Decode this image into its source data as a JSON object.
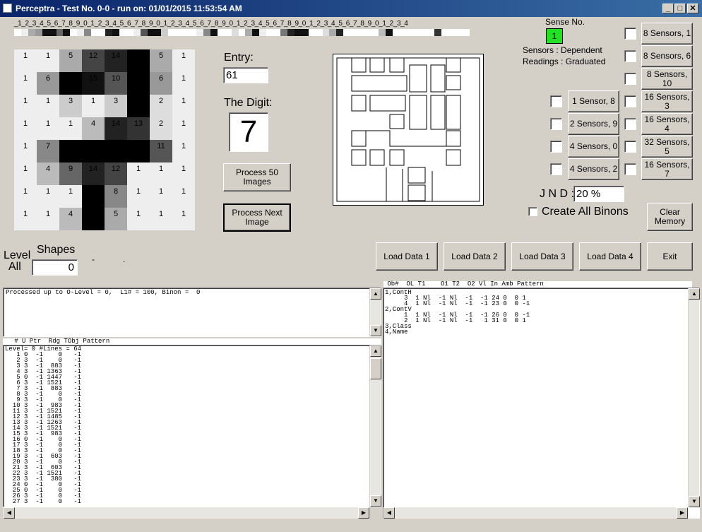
{
  "window": {
    "title": "Perceptra - Test No. 0-0 - run on: 01/01/2015  11:53:54 AM",
    "min": "_",
    "max": "□",
    "close": "✕"
  },
  "ruler": {
    "digits": "_1_2_3_4_5_6_7_8_9_0_1_2_3_4_5_6_7_8_9_0_1_2_3_4_5_6_7_8_9_0_1_2_3_4_5_6_7_8_9_0_1_2_3_4_5_6_7_8_9_0_1_2_3_4",
    "bar_shades": [
      "#fff",
      "#eee",
      "#aaa",
      "#999",
      "#111",
      "#111",
      "#666",
      "#111",
      "#fff",
      "#eee",
      "#888",
      "#fff",
      "#fff",
      "#222",
      "#111",
      "#fff",
      "#fff",
      "#eee",
      "#555",
      "#111",
      "#111",
      "#ccc",
      "#fff",
      "#fff",
      "#fff",
      "#fff",
      "#eee",
      "#888",
      "#111",
      "#fff",
      "#fff",
      "#ddd",
      "#fff",
      "#aaa",
      "#111",
      "#eee",
      "#fff",
      "#fff",
      "#777",
      "#222",
      "#111",
      "#111",
      "#fff",
      "#fff",
      "#ddd",
      "#aaa",
      "#222",
      "#fff",
      "#fff",
      "#fff",
      "#fff",
      "#fff",
      "#bbb",
      "#111",
      "#fff",
      "#fff",
      "#fff",
      "#fff",
      "#fff",
      "#fff",
      "#333",
      "#fff",
      "#fff",
      "#fff",
      "#fff"
    ]
  },
  "digit_grid": {
    "values": [
      [
        "1",
        "1",
        "5",
        "12",
        "14",
        "",
        "5",
        "1"
      ],
      [
        "1",
        "6",
        "",
        "15",
        "10",
        "",
        "6",
        "1"
      ],
      [
        "1",
        "1",
        "3",
        "1",
        "3",
        "",
        "2",
        "1"
      ],
      [
        "1",
        "1",
        "1",
        "4",
        "14",
        "13",
        "2",
        "1"
      ],
      [
        "1",
        "7",
        "",
        "",
        "",
        "",
        "11",
        "1"
      ],
      [
        "1",
        "4",
        "9",
        "14",
        "12",
        "1",
        "1",
        "1"
      ],
      [
        "1",
        "1",
        "1",
        "",
        "8",
        "1",
        "1",
        "1"
      ],
      [
        "1",
        "1",
        "4",
        "",
        "5",
        "1",
        "1",
        "1"
      ]
    ],
    "shades": [
      [
        "#eee",
        "#eee",
        "#aaa",
        "#444",
        "#222",
        "#000",
        "#aaa",
        "#eee"
      ],
      [
        "#eee",
        "#999",
        "#000",
        "#111",
        "#555",
        "#000",
        "#999",
        "#eee"
      ],
      [
        "#eee",
        "#eee",
        "#ccc",
        "#eee",
        "#ccc",
        "#000",
        "#ddd",
        "#eee"
      ],
      [
        "#eee",
        "#eee",
        "#eee",
        "#bbb",
        "#222",
        "#333",
        "#ddd",
        "#eee"
      ],
      [
        "#eee",
        "#888",
        "#000",
        "#000",
        "#000",
        "#000",
        "#555",
        "#eee"
      ],
      [
        "#eee",
        "#bbb",
        "#666",
        "#222",
        "#444",
        "#eee",
        "#eee",
        "#eee"
      ],
      [
        "#eee",
        "#eee",
        "#eee",
        "#000",
        "#888",
        "#eee",
        "#eee",
        "#eee"
      ],
      [
        "#eee",
        "#eee",
        "#bbb",
        "#000",
        "#aaa",
        "#eee",
        "#eee",
        "#eee"
      ]
    ]
  },
  "entry": {
    "label": "Entry:",
    "value": "61"
  },
  "digit": {
    "label": "The Digit:",
    "value": "7"
  },
  "buttons": {
    "process50": "Process 50 Images",
    "process_next": "Process Next Image",
    "load1": "Load Data 1",
    "load2": "Load Data 2",
    "load3": "Load Data 3",
    "load4": "Load Data 4",
    "exit": "Exit",
    "clear_memory": "Clear Memory"
  },
  "sense": {
    "label": "Sense No.",
    "value": "1",
    "sensors": "Sensors  :  Dependent",
    "readings": "Readings :  Graduated"
  },
  "sensor_buttons_right": [
    "8 Sensors, 1",
    "8 Sensors, 6",
    "8 Sensors, 10",
    "16 Sensors, 3",
    "16 Sensors, 4",
    "32 Sensors, 5",
    "16 Sensors, 7"
  ],
  "sensor_buttons_left": [
    "1 Sensor, 8",
    "2 Sensors, 9",
    "4 Sensors, 0",
    "4 Sensors, 2"
  ],
  "jnd": {
    "label": "J N D :",
    "value": "20 %"
  },
  "create_binons": "Create All Binons",
  "level": {
    "label": "Level",
    "sub": "All",
    "shapes_label": "Shapes",
    "shapes_value": "0",
    "dash": "-",
    "dot": "."
  },
  "status_text": "Processed up to O-Level = 0,  L1# = 100, Binon =  0",
  "list_header": "   # U Ptr  Rdg TObj Pattern",
  "list_text": "Level= 0 #Lines = 64\n   1 0  -1    0   -1\n   2 3  -1    0   -1\n   3 3  -1  883   -1\n   4 3  -1 1363   -1\n   5 0  -1 1447   -1\n   6 3  -1 1521   -1\n   7 3  -1  883   -1\n   8 3  -1    0   -1\n   9 3  -1    0   -1\n  10 3  -1  983   -1\n  11 3  -1 1521   -1\n  12 3  -1 1485   -1\n  13 3  -1 1263   -1\n  14 3  -1 1521   -1\n  15 3  -1  983   -1\n  16 0  -1    0   -1\n  17 3  -1    0   -1\n  18 3  -1    0   -1\n  19 3  -1  603   -1\n  20 3  -1    0   -1\n  21 3  -1  603   -1\n  22 3  -1 1521   -1\n  23 3  -1  380   -1\n  24 0  -1    0   -1\n  25 0  -1    0   -1\n  26 3  -1    0   -1\n  27 3  -1    0   -1",
  "obj_header": " Ob#  OL T1    O1 T2  O2 Vl In Amb Pattern",
  "obj_text": "1,ContH\n     3  1 Nl  -1 Nl  -1  -1 24 0  0 1\n     4  1 Nl  -1 Nl  -1  -1 23 0  0 -1\n2,ContV\n     1  1 Nl  -1 Nl  -1  -1 26 0  0 -1\n     2  1 Nl  -1 Nl  -1   1 31 0  0 1\n3,Class\n4,Name"
}
